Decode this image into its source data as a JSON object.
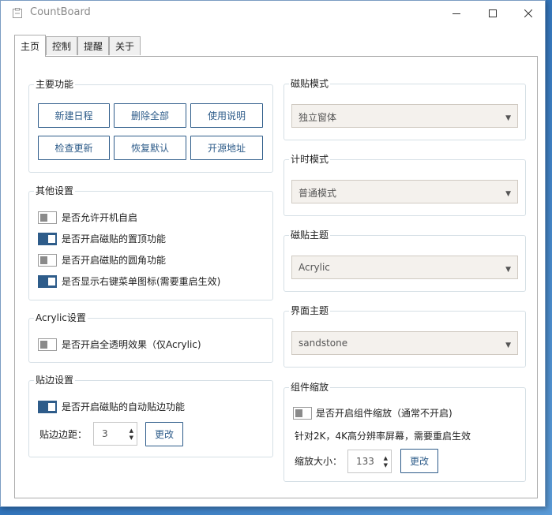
{
  "window": {
    "title": "CountBoard",
    "icon": "clipboard-icon"
  },
  "tabs": [
    {
      "label": "主页",
      "active": true
    },
    {
      "label": "控制",
      "active": false
    },
    {
      "label": "提醒",
      "active": false
    },
    {
      "label": "关于",
      "active": false
    }
  ],
  "main_features": {
    "title": "主要功能",
    "buttons": [
      "新建日程",
      "删除全部",
      "使用说明",
      "检查更新",
      "恢复默认",
      "开源地址"
    ]
  },
  "other_settings": {
    "title": "其他设置",
    "options": [
      {
        "label": "是否允许开机自启",
        "on": false
      },
      {
        "label": "是否开启磁贴的置顶功能",
        "on": true
      },
      {
        "label": "是否开启磁贴的圆角功能",
        "on": false
      },
      {
        "label": "是否显示右键菜单图标(需要重启生效)",
        "on": true
      }
    ]
  },
  "acrylic_settings": {
    "title": "Acrylic设置",
    "options": [
      {
        "label": "是否开启全透明效果（仅Acrylic)",
        "on": false
      }
    ]
  },
  "edge_settings": {
    "title": "贴边设置",
    "option": {
      "label": "是否开启磁贴的自动贴边功能",
      "on": true
    },
    "margin_label": "贴边边距：",
    "margin_value": "3",
    "change_label": "更改"
  },
  "tile_mode": {
    "title": "磁贴模式",
    "value": "独立窗体"
  },
  "timer_mode": {
    "title": "计时模式",
    "value": "普通模式"
  },
  "tile_theme": {
    "title": "磁贴主题",
    "value": "Acrylic"
  },
  "ui_theme": {
    "title": "界面主题",
    "value": "sandstone"
  },
  "component_scale": {
    "title": "组件缩放",
    "option": {
      "label": "是否开启组件缩放（通常不开启)",
      "on": false
    },
    "note": "针对2K，4K高分辨率屏幕，需要重启生效",
    "size_label": "缩放大小：",
    "size_value": "133",
    "change_label": "更改"
  },
  "colors": {
    "accent": "#2e5c8a",
    "select_bg": "#f4f1ed",
    "group_border": "#d5dfe5"
  }
}
